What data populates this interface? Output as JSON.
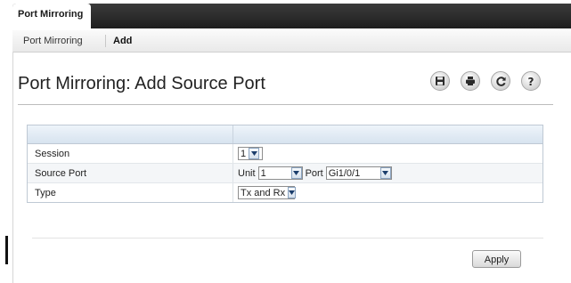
{
  "tabs": {
    "active_label": "Port Mirroring"
  },
  "subnav": {
    "items": [
      {
        "label": "Port Mirroring"
      },
      {
        "label": "Add"
      }
    ]
  },
  "page": {
    "title": "Port Mirroring: Add Source Port"
  },
  "toolbar": {
    "icons": [
      "save-icon",
      "print-icon",
      "refresh-icon",
      "help-icon"
    ]
  },
  "form": {
    "rows": [
      {
        "label": "Session",
        "session_value": "1"
      },
      {
        "label": "Source Port",
        "unit_label": "Unit",
        "unit_value": "1",
        "port_label": "Port",
        "port_value": "Gi1/0/1"
      },
      {
        "label": "Type",
        "type_value": "Tx and Rx"
      }
    ]
  },
  "actions": {
    "apply_label": "Apply"
  }
}
